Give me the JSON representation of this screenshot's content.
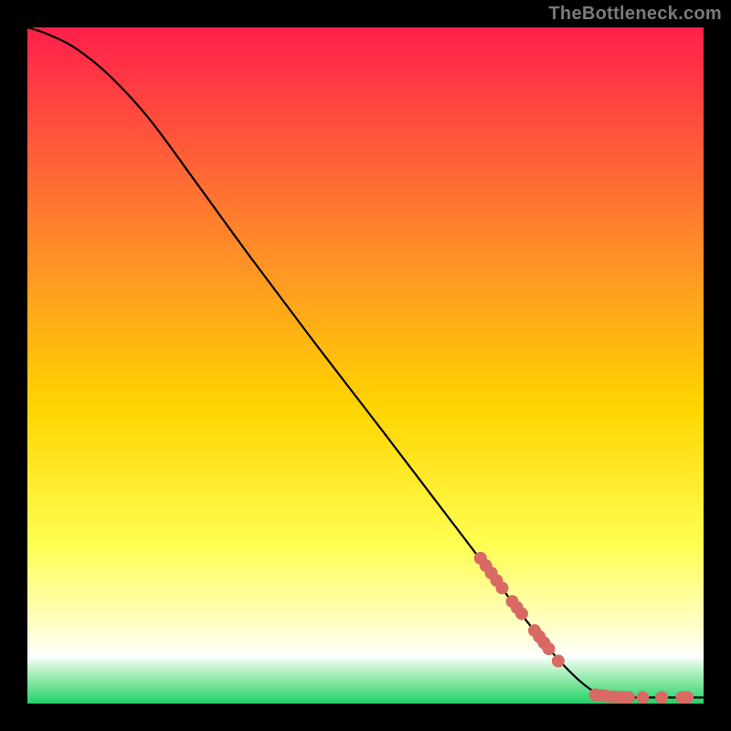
{
  "watermark": "TheBottleneck.com",
  "colors": {
    "top": "#ff1f4b",
    "mid_upper": "#ff8a2a",
    "mid": "#ffd400",
    "mid_lower": "#ffff55",
    "lower_pale": "#ffffcc",
    "white": "#ffffff",
    "green1": "#b9f2c8",
    "green2": "#6fe396",
    "green3": "#20d268",
    "curve": "#000000",
    "marker": "#d86a63",
    "frame": "#000000"
  },
  "chart_data": {
    "type": "line",
    "title": "",
    "xlabel": "",
    "ylabel": "",
    "xlim": [
      0,
      100
    ],
    "ylim": [
      0,
      100
    ],
    "curve": [
      {
        "x": 0,
        "y": 100
      },
      {
        "x": 3,
        "y": 99
      },
      {
        "x": 7,
        "y": 97
      },
      {
        "x": 12,
        "y": 93
      },
      {
        "x": 18,
        "y": 86.5
      },
      {
        "x": 25,
        "y": 77
      },
      {
        "x": 33,
        "y": 66
      },
      {
        "x": 42,
        "y": 54
      },
      {
        "x": 52,
        "y": 41
      },
      {
        "x": 60,
        "y": 30.5
      },
      {
        "x": 68,
        "y": 20
      },
      {
        "x": 74,
        "y": 12
      },
      {
        "x": 79,
        "y": 6
      },
      {
        "x": 83,
        "y": 2.3
      },
      {
        "x": 86,
        "y": 1.0
      },
      {
        "x": 90,
        "y": 0.9
      },
      {
        "x": 94,
        "y": 0.9
      },
      {
        "x": 100,
        "y": 0.9
      }
    ],
    "markers": [
      {
        "x": 67.0,
        "y": 21.5
      },
      {
        "x": 67.8,
        "y": 20.4
      },
      {
        "x": 68.6,
        "y": 19.3
      },
      {
        "x": 69.4,
        "y": 18.2
      },
      {
        "x": 70.2,
        "y": 17.1
      },
      {
        "x": 71.7,
        "y": 15.1
      },
      {
        "x": 72.4,
        "y": 14.2
      },
      {
        "x": 73.1,
        "y": 13.3
      },
      {
        "x": 75.0,
        "y": 10.8
      },
      {
        "x": 75.7,
        "y": 9.9
      },
      {
        "x": 76.4,
        "y": 9.0
      },
      {
        "x": 77.1,
        "y": 8.1
      },
      {
        "x": 78.5,
        "y": 6.3
      },
      {
        "x": 84.0,
        "y": 1.3
      },
      {
        "x": 84.8,
        "y": 1.2
      },
      {
        "x": 85.6,
        "y": 1.1
      },
      {
        "x": 86.4,
        "y": 1.0
      },
      {
        "x": 87.2,
        "y": 1.0
      },
      {
        "x": 88.0,
        "y": 0.95
      },
      {
        "x": 88.9,
        "y": 0.92
      },
      {
        "x": 91.0,
        "y": 0.9
      },
      {
        "x": 93.8,
        "y": 0.9
      },
      {
        "x": 96.8,
        "y": 0.9
      },
      {
        "x": 97.6,
        "y": 0.9
      }
    ]
  }
}
